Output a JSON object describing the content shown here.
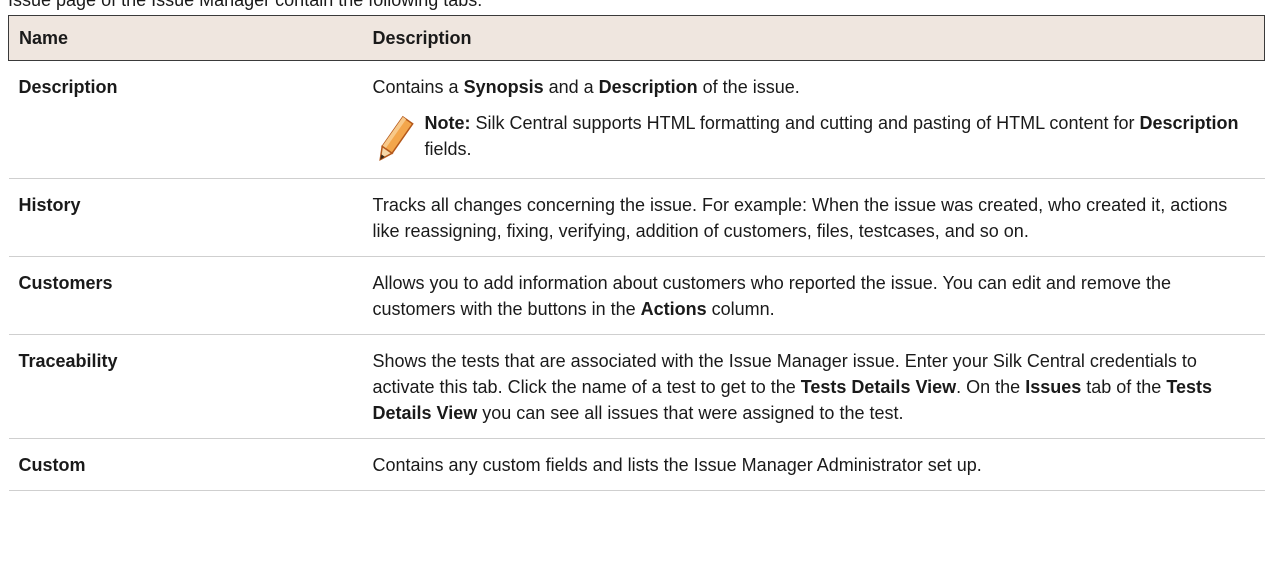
{
  "header_cut_text": "Issue page of the Issue Manager contain the following tabs:",
  "table": {
    "headers": [
      "Name",
      "Description"
    ],
    "rows": [
      {
        "name": "Description",
        "desc_parts": [
          "Contains a ",
          "Synopsis",
          " and a ",
          "Description",
          " of the issue."
        ],
        "note": {
          "label": "Note:",
          "parts": [
            " Silk Central supports HTML formatting and cutting and pasting of HTML content for ",
            "Description",
            " fields."
          ]
        }
      },
      {
        "name": "History",
        "desc_parts": [
          "Tracks all changes concerning the issue. For example: When the issue was created, who created it, actions like reassigning, fixing, verifying, addition of customers, files, testcases, and so on."
        ]
      },
      {
        "name": "Customers",
        "desc_parts": [
          "Allows you to add information about customers who reported the issue. You can edit and remove the customers with the buttons in the ",
          "Actions",
          " column."
        ]
      },
      {
        "name": "Traceability",
        "desc_parts": [
          "Shows the tests that are associated with the Issue Manager issue. Enter your Silk Central credentials to activate this tab. Click the name of a test to get to the ",
          "Tests Details View",
          ". On the ",
          "Issues",
          " tab of the ",
          "Tests Details View",
          " you can see all issues that were assigned to the test."
        ]
      },
      {
        "name": "Custom",
        "desc_parts": [
          "Contains any custom fields and lists the Issue Manager Administrator set up."
        ]
      }
    ]
  },
  "colors": {
    "header_bg": "#efe6df",
    "pencil_orange": "#e8822a"
  },
  "icons": {
    "note": "pencil-icon"
  }
}
